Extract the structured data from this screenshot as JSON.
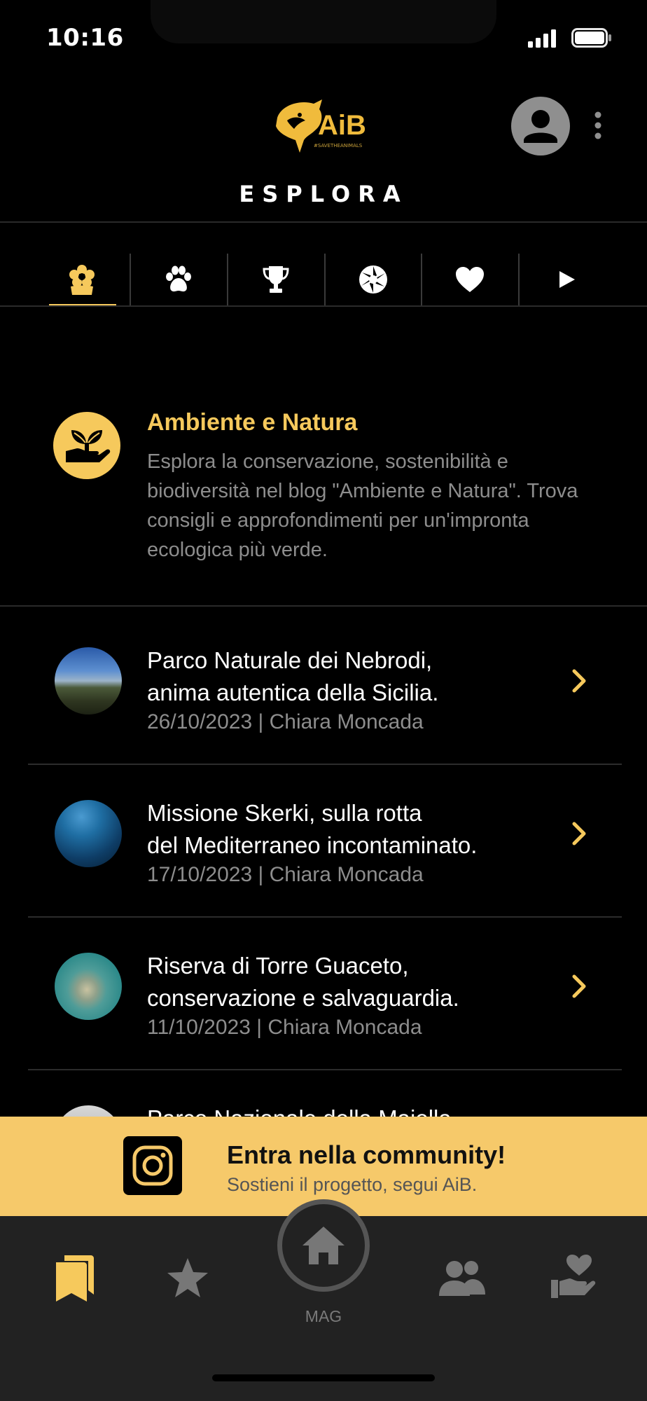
{
  "status_bar": {
    "time": "10:16"
  },
  "header": {
    "logo_alt": "AiB",
    "logo_tagline": "#SAVETHEANIMALS",
    "title": "ESPLORA"
  },
  "tabs": [
    {
      "icon": "flower-icon",
      "active": true
    },
    {
      "icon": "paw-icon",
      "active": false
    },
    {
      "icon": "trophy-icon",
      "active": false
    },
    {
      "icon": "aperture-icon",
      "active": false
    },
    {
      "icon": "heart-icon",
      "active": false
    },
    {
      "icon": "play-icon",
      "active": false
    }
  ],
  "intro": {
    "title": "Ambiente e Natura",
    "description": "Esplora la conservazione, sostenibilità e biodiversità nel blog \"Ambiente e Natura\". Trova consigli e approfondimenti per un'impronta ecologica più verde."
  },
  "articles": [
    {
      "title": "Parco Naturale dei Nebrodi,\nanima autentica della Sicilia.",
      "meta": "26/10/2023 | Chiara Moncada"
    },
    {
      "title": "Missione Skerki, sulla rotta\ndel Mediterraneo incontaminato.",
      "meta": "17/10/2023 | Chiara Moncada"
    },
    {
      "title": "Riserva di Torre Guaceto,\nconservazione e salvaguardia.",
      "meta": "11/10/2023 | Chiara Moncada"
    },
    {
      "title": "Parco Nazionale della Maiella",
      "meta": ""
    }
  ],
  "banner": {
    "title": "Entra nella community!",
    "subtitle": "Sostieni il progetto, segui AiB."
  },
  "bottom_nav": {
    "center_label": "MAG",
    "items": [
      "bookmarks-icon",
      "star-icon",
      "home-icon",
      "users-icon",
      "donate-icon"
    ]
  },
  "colors": {
    "accent": "#f6c95c",
    "banner": "#f6c96a",
    "inactive_icon": "#8a8a8a",
    "background": "#000000"
  }
}
